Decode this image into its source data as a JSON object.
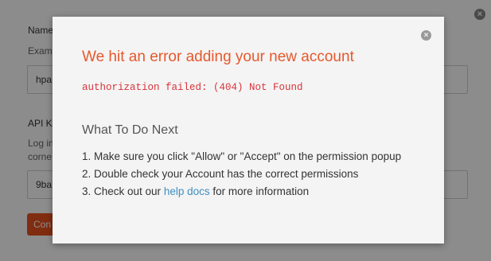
{
  "background": {
    "name_label": "Name",
    "name_help": "Exam",
    "name_value": "hpa",
    "api_key_label": "API Ke",
    "api_key_help_line1": "Log in",
    "api_key_help_line2": "corne",
    "api_key_value": "9ba",
    "connect_button_label": "Con",
    "close_icon": "close-icon"
  },
  "modal": {
    "title": "We hit an error adding your new account",
    "error_message": "authorization failed: (404) Not Found",
    "subtitle": "What To Do Next",
    "steps": [
      {
        "text": "1. Make sure you click \"Allow\" or \"Accept\" on the permission popup"
      },
      {
        "text": "2. Double check your Account has the correct permissions"
      },
      {
        "prefix": "3. Check out our ",
        "link": "help docs",
        "suffix": " for more information"
      }
    ],
    "close_icon": "close-icon"
  },
  "colors": {
    "title": "#e6582c",
    "error": "#d9333a",
    "link": "#3f8fbf",
    "button": "#e9501f"
  }
}
